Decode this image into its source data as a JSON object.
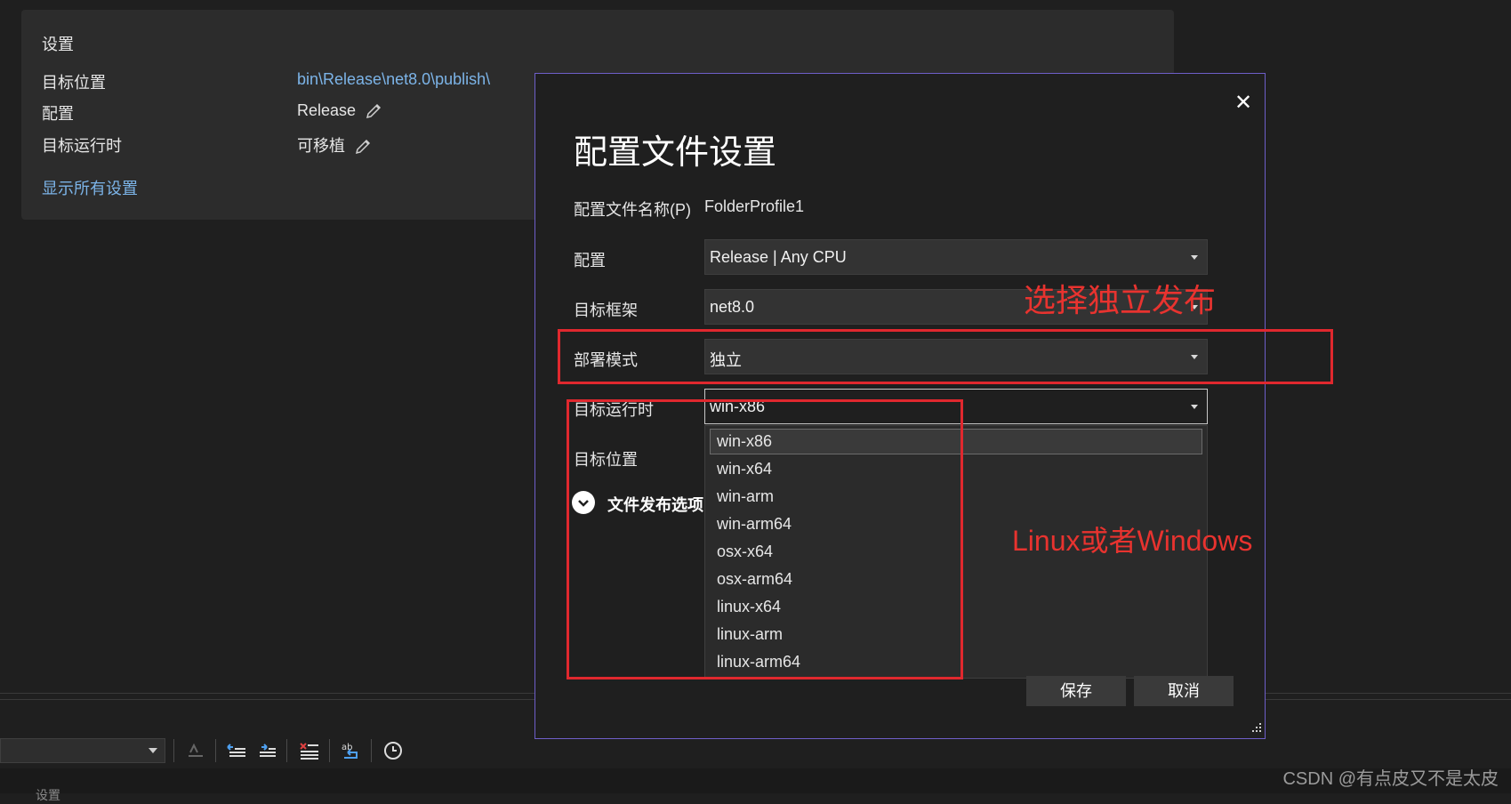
{
  "settings_panel": {
    "title": "设置",
    "rows": [
      {
        "label": "目标位置",
        "value": "bin\\Release\\net8.0\\publish\\"
      },
      {
        "label": "配置",
        "value": "Release"
      },
      {
        "label": "目标运行时",
        "value": "可移植"
      }
    ],
    "show_all_link": "显示所有设置"
  },
  "dialog": {
    "title": "配置文件设置",
    "close_glyph": "✕",
    "profile_name_label": "配置文件名称(P)",
    "profile_name_value": "FolderProfile1",
    "configuration_label": "配置",
    "configuration_value": "Release | Any CPU",
    "framework_label": "目标框架",
    "framework_value": "net8.0",
    "deploy_mode_label": "部署模式",
    "deploy_mode_value": "独立",
    "runtime_label": "目标运行时",
    "runtime_value": "win-x86",
    "location_label": "目标位置",
    "publish_options_label": "文件发布选项",
    "runtime_options": [
      "win-x86",
      "win-x64",
      "win-arm",
      "win-arm64",
      "osx-x64",
      "osx-arm64",
      "linux-x64",
      "linux-arm",
      "linux-arm64"
    ],
    "selected_runtime": "win-x86",
    "save_label": "保存",
    "cancel_label": "取消"
  },
  "annotations": {
    "deploy_note": "选择独立发布",
    "runtime_note": "Linux或者Windows",
    "color": "#e0282e"
  },
  "bottom": {
    "partial_text": "设置",
    "watermark": "CSDN @有点皮又不是太皮"
  },
  "colors": {
    "background": "#1f1f1f",
    "panel": "#2c2c2c",
    "link": "#7cb4e8",
    "dialog_border": "#6e5fc9"
  }
}
